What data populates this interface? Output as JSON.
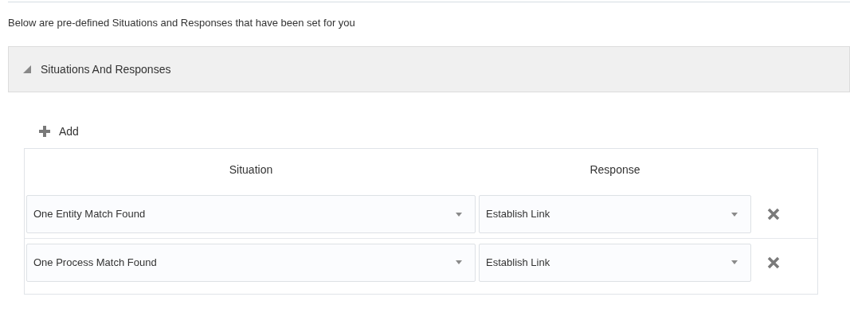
{
  "intro": "Below are pre-defined Situations and Responses that have been set for you",
  "section": {
    "title": "Situations And Responses",
    "expanded": true
  },
  "add_button": "Add",
  "table": {
    "columns": [
      "Situation",
      "Response"
    ],
    "rows": [
      {
        "situation": "One Entity Match Found",
        "response": "Establish Link"
      },
      {
        "situation": "One Process Match Found",
        "response": "Establish Link"
      }
    ]
  }
}
